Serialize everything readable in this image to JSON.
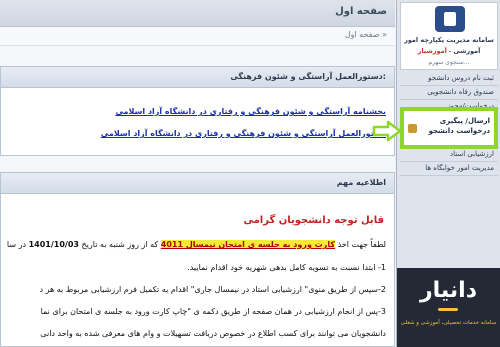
{
  "header": {
    "title": "صفحه اول"
  },
  "breadcrumb": {
    "text": "صفحه اول »"
  },
  "panel_rules": {
    "title": "دستورالعمل آراستگی و شئون فرهنگی:",
    "links": [
      "بخشنامه آراستگی و شئون فرهنگی و رفتاری در دانشگاه آزاد اسلامی",
      "دستورالعمل آراستگی و شئون فرهنگی و رفتاری در دانشگاه آزاد اسلامی"
    ]
  },
  "panel_notice": {
    "title": "اطلاعیه مهم",
    "heading": "قابل توجه دانشجویان گرامی",
    "line1_pre": "لطفاً جهت اخذ",
    "line1_highlight": "کارت ورود به جلسه ی امتحان نیمسال 4011",
    "line1_mid": "که از روز شنبه به تاریخ",
    "line1_date": "1401/10/03",
    "line1_post": "در سا",
    "line2": "1- ابتدا نسبت به تسویه کامل بدهی شهریه خود اقدام نمایید.",
    "line3": "2-سپس از طریق منوی\" ارزشیابی استاد در نیمسال جاری\" اقدام به تکمیل فرم ارزشیابی مربوط به هر د",
    "line4": "3-پس از انجام ارزشیابی در همان صفحه از طریق دکمه ی \"چاپ کارت ورود به جلسه ی امتحان برای نما",
    "line5": "دانشجویان می توانند برای کسب اطلاع در خصوص دریافت تسهیلات و وام های معرفی شده به واحد دانی"
  },
  "sidebar": {
    "system_line1": "سامانه مدیریت یکپارچه امور",
    "system_line2a": "آموزشی",
    "system_line2b": "آموزشیار",
    "system_sub": "سنجوی سهرم...",
    "items": [
      "ثبت نام دروس دانشجو",
      "صندوق رفاه دانشجویی",
      "درخواست/مجوز",
      "ارسال/ پیگیری درخواست دانشجو",
      "ارزشیابی استاد",
      "مدیریت امور خوابگاه ها"
    ],
    "highlighted_item": "ارسال/ پیگیری درخواست دانشجو"
  },
  "watermark": {
    "name": "دانیار",
    "subtitle": "سامانه خدمات تحصیلی، آموزشی و شغلی"
  },
  "colors": {
    "highlight_border": "#8ed62b",
    "link": "#1a2fb0",
    "notice_heading": "#c22222",
    "highlight_bg": "#f6ea37"
  }
}
